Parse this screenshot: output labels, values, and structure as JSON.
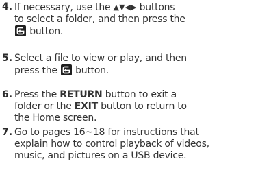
{
  "steps": [
    {
      "number": "4.",
      "line1_before_arrows": "If necessary, use the",
      "arrows": "▲▼◀▶",
      "line1_after_arrows": "buttons",
      "line2": "to select a folder, and then press the",
      "line3_after_icon": "button.",
      "icon": "enter-icon"
    },
    {
      "number": "5.",
      "line1": "Select a file to view or play, and then",
      "line2_before_icon": "press the",
      "line2_after_icon": "button.",
      "icon": "enter-icon"
    },
    {
      "number": "6.",
      "line1_before": "Press the",
      "line1_bold": "RETURN",
      "line1_after": "button to exit a",
      "line2_before": "folder or the",
      "line2_bold": "EXIT",
      "line2_after": "button to return to",
      "line3": "the Home screen."
    },
    {
      "number": "7.",
      "line1": "Go to pages 16~18 for instructions that",
      "line2": "explain how to control playback of videos,",
      "line3": "music, and pictures on a USB device."
    }
  ]
}
